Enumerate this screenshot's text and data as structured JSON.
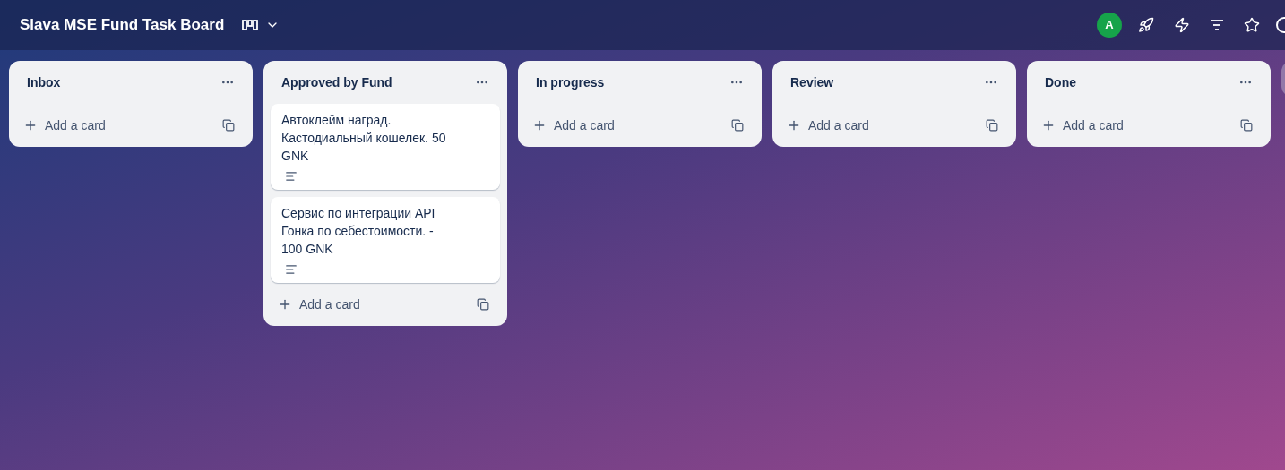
{
  "board": {
    "title": "Slava MSE Fund Task Board"
  },
  "header": {
    "avatar": "A"
  },
  "lists": [
    {
      "title": "Inbox",
      "add_label": "Add a card"
    },
    {
      "title": "Approved by Fund",
      "cards": [
        {
          "title": "Автоклейм наград. Кастодиальный кошелек. 50 GNK",
          "has_description": true
        },
        {
          "title": "Сервис по интеграции API Гонка по себестоимости. - 100 GNK",
          "has_description": true
        }
      ],
      "add_label": "Add a card"
    },
    {
      "title": "In progress",
      "add_label": "Add a card"
    },
    {
      "title": "Review",
      "add_label": "Add a card"
    },
    {
      "title": "Done",
      "add_label": "Add a card"
    }
  ]
}
